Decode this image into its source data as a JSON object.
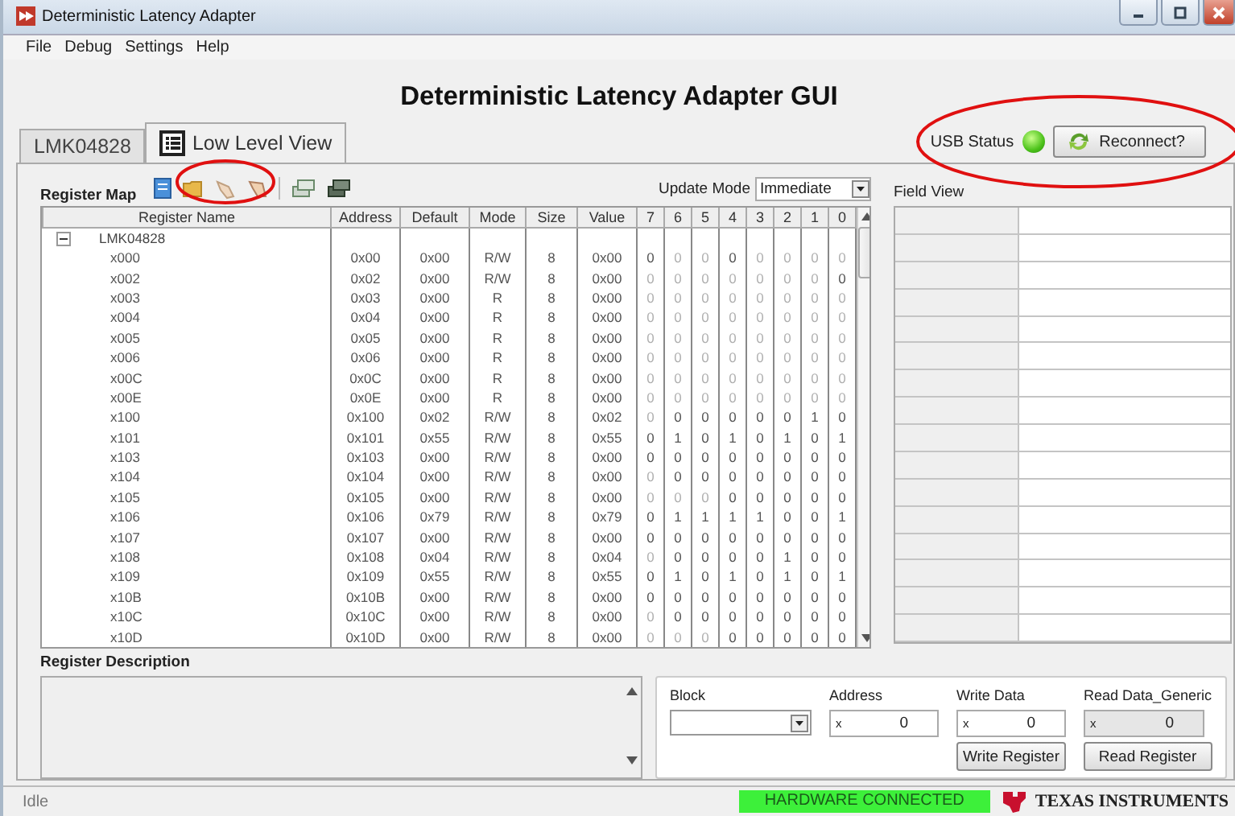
{
  "window": {
    "title": "Deterministic Latency Adapter"
  },
  "menu": [
    "File",
    "Debug",
    "Settings",
    "Help"
  ],
  "app_title": "Deterministic Latency Adapter GUI",
  "tabs": [
    {
      "label": "LMK04828",
      "selected": false
    },
    {
      "label": "Low Level View",
      "selected": true
    }
  ],
  "usb_status": {
    "label": "USB Status",
    "on": true
  },
  "reconnect_button": "Reconnect?",
  "register_map": {
    "title": "Register Map",
    "update_mode_label": "Update Mode",
    "update_mode": "Immediate",
    "columns": [
      "Register Name",
      "Address",
      "Default",
      "Mode",
      "Size",
      "Value",
      "7",
      "6",
      "5",
      "4",
      "3",
      "2",
      "1",
      "0"
    ],
    "tree": {
      "label": "LMK04828",
      "expanded": true,
      "children": [
        {
          "name": "x000",
          "address": "0x00",
          "default": "0x00",
          "mode": "R/W",
          "size": "8",
          "value": "0x00",
          "bits": [
            {
              "v": "0",
              "disabled": false
            },
            {
              "v": "0",
              "disabled": true
            },
            {
              "v": "0",
              "disabled": true
            },
            {
              "v": "0",
              "disabled": false
            },
            {
              "v": "0",
              "disabled": true
            },
            {
              "v": "0",
              "disabled": true
            },
            {
              "v": "0",
              "disabled": true
            },
            {
              "v": "0",
              "disabled": true
            }
          ]
        },
        {
          "name": "x002",
          "address": "0x02",
          "default": "0x00",
          "mode": "R/W",
          "size": "8",
          "value": "0x00",
          "bits": [
            {
              "v": "0",
              "disabled": true
            },
            {
              "v": "0",
              "disabled": true
            },
            {
              "v": "0",
              "disabled": true
            },
            {
              "v": "0",
              "disabled": true
            },
            {
              "v": "0",
              "disabled": true
            },
            {
              "v": "0",
              "disabled": true
            },
            {
              "v": "0",
              "disabled": true
            },
            {
              "v": "0",
              "disabled": false
            }
          ]
        },
        {
          "name": "x003",
          "address": "0x03",
          "default": "0x00",
          "mode": "R",
          "size": "8",
          "value": "0x00",
          "bits": [
            {
              "v": "0",
              "disabled": true
            },
            {
              "v": "0",
              "disabled": true
            },
            {
              "v": "0",
              "disabled": true
            },
            {
              "v": "0",
              "disabled": true
            },
            {
              "v": "0",
              "disabled": true
            },
            {
              "v": "0",
              "disabled": true
            },
            {
              "v": "0",
              "disabled": true
            },
            {
              "v": "0",
              "disabled": true
            }
          ]
        },
        {
          "name": "x004",
          "address": "0x04",
          "default": "0x00",
          "mode": "R",
          "size": "8",
          "value": "0x00",
          "bits": [
            {
              "v": "0",
              "disabled": true
            },
            {
              "v": "0",
              "disabled": true
            },
            {
              "v": "0",
              "disabled": true
            },
            {
              "v": "0",
              "disabled": true
            },
            {
              "v": "0",
              "disabled": true
            },
            {
              "v": "0",
              "disabled": true
            },
            {
              "v": "0",
              "disabled": true
            },
            {
              "v": "0",
              "disabled": true
            }
          ]
        },
        {
          "name": "x005",
          "address": "0x05",
          "default": "0x00",
          "mode": "R",
          "size": "8",
          "value": "0x00",
          "bits": [
            {
              "v": "0",
              "disabled": true
            },
            {
              "v": "0",
              "disabled": true
            },
            {
              "v": "0",
              "disabled": true
            },
            {
              "v": "0",
              "disabled": true
            },
            {
              "v": "0",
              "disabled": true
            },
            {
              "v": "0",
              "disabled": true
            },
            {
              "v": "0",
              "disabled": true
            },
            {
              "v": "0",
              "disabled": true
            }
          ]
        },
        {
          "name": "x006",
          "address": "0x06",
          "default": "0x00",
          "mode": "R",
          "size": "8",
          "value": "0x00",
          "bits": [
            {
              "v": "0",
              "disabled": true
            },
            {
              "v": "0",
              "disabled": true
            },
            {
              "v": "0",
              "disabled": true
            },
            {
              "v": "0",
              "disabled": true
            },
            {
              "v": "0",
              "disabled": true
            },
            {
              "v": "0",
              "disabled": true
            },
            {
              "v": "0",
              "disabled": true
            },
            {
              "v": "0",
              "disabled": true
            }
          ]
        },
        {
          "name": "x00C",
          "address": "0x0C",
          "default": "0x00",
          "mode": "R",
          "size": "8",
          "value": "0x00",
          "bits": [
            {
              "v": "0",
              "disabled": true
            },
            {
              "v": "0",
              "disabled": true
            },
            {
              "v": "0",
              "disabled": true
            },
            {
              "v": "0",
              "disabled": true
            },
            {
              "v": "0",
              "disabled": true
            },
            {
              "v": "0",
              "disabled": true
            },
            {
              "v": "0",
              "disabled": true
            },
            {
              "v": "0",
              "disabled": true
            }
          ]
        },
        {
          "name": "x00E",
          "address": "0x0E",
          "default": "0x00",
          "mode": "R",
          "size": "8",
          "value": "0x00",
          "bits": [
            {
              "v": "0",
              "disabled": true
            },
            {
              "v": "0",
              "disabled": true
            },
            {
              "v": "0",
              "disabled": true
            },
            {
              "v": "0",
              "disabled": true
            },
            {
              "v": "0",
              "disabled": true
            },
            {
              "v": "0",
              "disabled": true
            },
            {
              "v": "0",
              "disabled": true
            },
            {
              "v": "0",
              "disabled": true
            }
          ]
        },
        {
          "name": "x100",
          "address": "0x100",
          "default": "0x02",
          "mode": "R/W",
          "size": "8",
          "value": "0x02",
          "bits": [
            {
              "v": "0",
              "disabled": true
            },
            {
              "v": "0",
              "disabled": false
            },
            {
              "v": "0",
              "disabled": false
            },
            {
              "v": "0",
              "disabled": false
            },
            {
              "v": "0",
              "disabled": false
            },
            {
              "v": "0",
              "disabled": false
            },
            {
              "v": "1",
              "disabled": false
            },
            {
              "v": "0",
              "disabled": false
            }
          ]
        },
        {
          "name": "x101",
          "address": "0x101",
          "default": "0x55",
          "mode": "R/W",
          "size": "8",
          "value": "0x55",
          "bits": [
            {
              "v": "0",
              "disabled": false
            },
            {
              "v": "1",
              "disabled": false
            },
            {
              "v": "0",
              "disabled": false
            },
            {
              "v": "1",
              "disabled": false
            },
            {
              "v": "0",
              "disabled": false
            },
            {
              "v": "1",
              "disabled": false
            },
            {
              "v": "0",
              "disabled": false
            },
            {
              "v": "1",
              "disabled": false
            }
          ]
        },
        {
          "name": "x103",
          "address": "0x103",
          "default": "0x00",
          "mode": "R/W",
          "size": "8",
          "value": "0x00",
          "bits": [
            {
              "v": "0",
              "disabled": false
            },
            {
              "v": "0",
              "disabled": false
            },
            {
              "v": "0",
              "disabled": false
            },
            {
              "v": "0",
              "disabled": false
            },
            {
              "v": "0",
              "disabled": false
            },
            {
              "v": "0",
              "disabled": false
            },
            {
              "v": "0",
              "disabled": false
            },
            {
              "v": "0",
              "disabled": false
            }
          ]
        },
        {
          "name": "x104",
          "address": "0x104",
          "default": "0x00",
          "mode": "R/W",
          "size": "8",
          "value": "0x00",
          "bits": [
            {
              "v": "0",
              "disabled": true
            },
            {
              "v": "0",
              "disabled": false
            },
            {
              "v": "0",
              "disabled": false
            },
            {
              "v": "0",
              "disabled": false
            },
            {
              "v": "0",
              "disabled": false
            },
            {
              "v": "0",
              "disabled": false
            },
            {
              "v": "0",
              "disabled": false
            },
            {
              "v": "0",
              "disabled": false
            }
          ]
        },
        {
          "name": "x105",
          "address": "0x105",
          "default": "0x00",
          "mode": "R/W",
          "size": "8",
          "value": "0x00",
          "bits": [
            {
              "v": "0",
              "disabled": true
            },
            {
              "v": "0",
              "disabled": true
            },
            {
              "v": "0",
              "disabled": true
            },
            {
              "v": "0",
              "disabled": false
            },
            {
              "v": "0",
              "disabled": false
            },
            {
              "v": "0",
              "disabled": false
            },
            {
              "v": "0",
              "disabled": false
            },
            {
              "v": "0",
              "disabled": false
            }
          ]
        },
        {
          "name": "x106",
          "address": "0x106",
          "default": "0x79",
          "mode": "R/W",
          "size": "8",
          "value": "0x79",
          "bits": [
            {
              "v": "0",
              "disabled": false
            },
            {
              "v": "1",
              "disabled": false
            },
            {
              "v": "1",
              "disabled": false
            },
            {
              "v": "1",
              "disabled": false
            },
            {
              "v": "1",
              "disabled": false
            },
            {
              "v": "0",
              "disabled": false
            },
            {
              "v": "0",
              "disabled": false
            },
            {
              "v": "1",
              "disabled": false
            }
          ]
        },
        {
          "name": "x107",
          "address": "0x107",
          "default": "0x00",
          "mode": "R/W",
          "size": "8",
          "value": "0x00",
          "bits": [
            {
              "v": "0",
              "disabled": false
            },
            {
              "v": "0",
              "disabled": false
            },
            {
              "v": "0",
              "disabled": false
            },
            {
              "v": "0",
              "disabled": false
            },
            {
              "v": "0",
              "disabled": false
            },
            {
              "v": "0",
              "disabled": false
            },
            {
              "v": "0",
              "disabled": false
            },
            {
              "v": "0",
              "disabled": false
            }
          ]
        },
        {
          "name": "x108",
          "address": "0x108",
          "default": "0x04",
          "mode": "R/W",
          "size": "8",
          "value": "0x04",
          "bits": [
            {
              "v": "0",
              "disabled": true
            },
            {
              "v": "0",
              "disabled": false
            },
            {
              "v": "0",
              "disabled": false
            },
            {
              "v": "0",
              "disabled": false
            },
            {
              "v": "0",
              "disabled": false
            },
            {
              "v": "1",
              "disabled": false
            },
            {
              "v": "0",
              "disabled": false
            },
            {
              "v": "0",
              "disabled": false
            }
          ]
        },
        {
          "name": "x109",
          "address": "0x109",
          "default": "0x55",
          "mode": "R/W",
          "size": "8",
          "value": "0x55",
          "bits": [
            {
              "v": "0",
              "disabled": false
            },
            {
              "v": "1",
              "disabled": false
            },
            {
              "v": "0",
              "disabled": false
            },
            {
              "v": "1",
              "disabled": false
            },
            {
              "v": "0",
              "disabled": false
            },
            {
              "v": "1",
              "disabled": false
            },
            {
              "v": "0",
              "disabled": false
            },
            {
              "v": "1",
              "disabled": false
            }
          ]
        },
        {
          "name": "x10B",
          "address": "0x10B",
          "default": "0x00",
          "mode": "R/W",
          "size": "8",
          "value": "0x00",
          "bits": [
            {
              "v": "0",
              "disabled": false
            },
            {
              "v": "0",
              "disabled": false
            },
            {
              "v": "0",
              "disabled": false
            },
            {
              "v": "0",
              "disabled": false
            },
            {
              "v": "0",
              "disabled": false
            },
            {
              "v": "0",
              "disabled": false
            },
            {
              "v": "0",
              "disabled": false
            },
            {
              "v": "0",
              "disabled": false
            }
          ]
        },
        {
          "name": "x10C",
          "address": "0x10C",
          "default": "0x00",
          "mode": "R/W",
          "size": "8",
          "value": "0x00",
          "bits": [
            {
              "v": "0",
              "disabled": true
            },
            {
              "v": "0",
              "disabled": false
            },
            {
              "v": "0",
              "disabled": false
            },
            {
              "v": "0",
              "disabled": false
            },
            {
              "v": "0",
              "disabled": false
            },
            {
              "v": "0",
              "disabled": false
            },
            {
              "v": "0",
              "disabled": false
            },
            {
              "v": "0",
              "disabled": false
            }
          ]
        },
        {
          "name": "x10D",
          "address": "0x10D",
          "default": "0x00",
          "mode": "R/W",
          "size": "8",
          "value": "0x00",
          "bits": [
            {
              "v": "0",
              "disabled": true
            },
            {
              "v": "0",
              "disabled": true
            },
            {
              "v": "0",
              "disabled": true
            },
            {
              "v": "0",
              "disabled": false
            },
            {
              "v": "0",
              "disabled": false
            },
            {
              "v": "0",
              "disabled": false
            },
            {
              "v": "0",
              "disabled": false
            },
            {
              "v": "0",
              "disabled": false
            }
          ]
        }
      ]
    }
  },
  "field_view": {
    "title": "Field View"
  },
  "register_description": {
    "title": "Register Description"
  },
  "block": {
    "label": "Block"
  },
  "fields": [
    {
      "label": "Address",
      "prefix": "x",
      "value": "0",
      "disabled": false
    },
    {
      "label": "Write Data",
      "prefix": "x",
      "value": "0",
      "disabled": false
    },
    {
      "label": "Read Data_Generic",
      "prefix": "x",
      "value": "0",
      "disabled": true
    }
  ],
  "buttons": [
    "Write Register",
    "Read Register"
  ],
  "status_bar": {
    "text": "Idle",
    "hardware": "HARDWARE CONNECTED",
    "logo": "TEXAS INSTRUMENTS"
  }
}
